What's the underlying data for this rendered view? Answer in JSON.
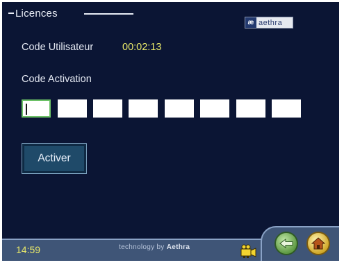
{
  "header": {
    "title": "Licences",
    "brand_text": "aethra",
    "brand_mark": "æ"
  },
  "form": {
    "user_code_label": "Code Utilisateur",
    "user_code_value": "00:02:13",
    "activation_label": "Code Activation",
    "activation_boxes": [
      "",
      "",
      "",
      "",
      "",
      "",
      "",
      ""
    ],
    "activate_button": "Activer"
  },
  "taskbar": {
    "time": "14:59",
    "tech_prefix": "technology by",
    "tech_brand": "Aethra",
    "icons": {
      "camera": "video-camera-icon",
      "back": "back-arrow-icon",
      "home": "home-icon"
    }
  },
  "colors": {
    "background": "#0b1534",
    "accent_yellow": "#e8e86a",
    "button_bg": "#1f4a69",
    "focus_border": "#6cc166",
    "taskbar": "#3f5577"
  }
}
